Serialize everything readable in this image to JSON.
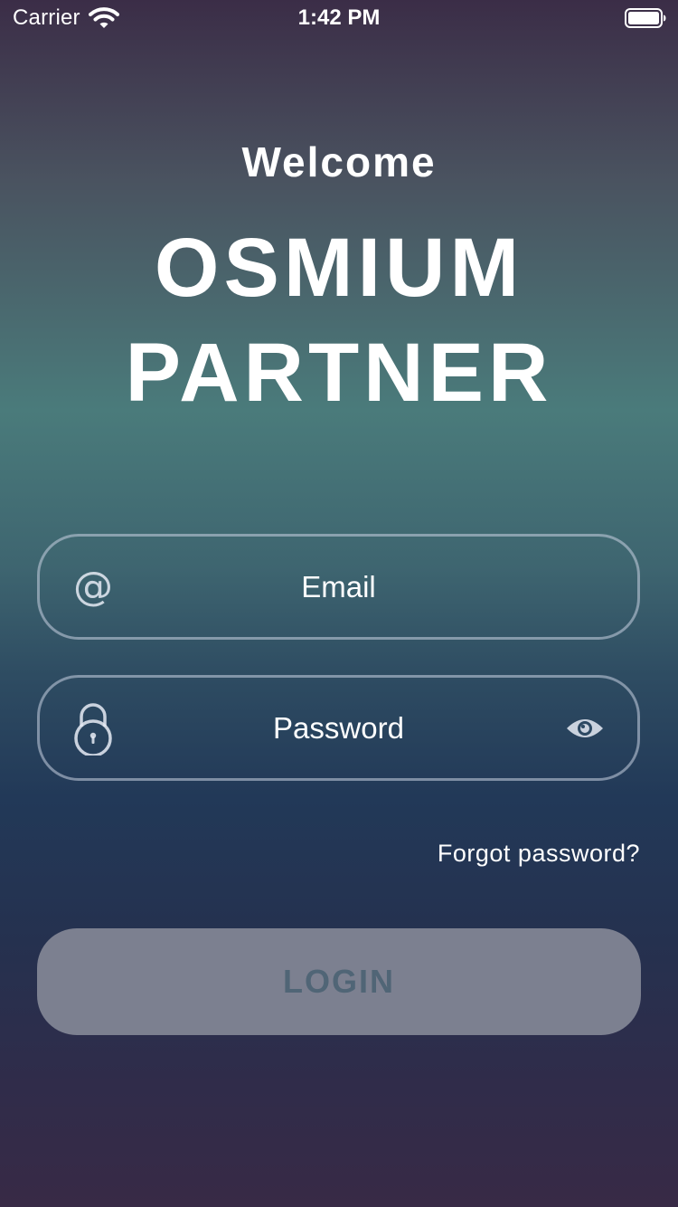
{
  "status_bar": {
    "carrier": "Carrier",
    "time": "1:42 PM",
    "icons": [
      "wifi-icon",
      "battery-icon"
    ]
  },
  "header": {
    "welcome": "Welcome",
    "brand_line_1": "OSMIUM",
    "brand_line_2": "PARTNER"
  },
  "form": {
    "email": {
      "value": "",
      "placeholder": "Email",
      "icon": "at-icon"
    },
    "password": {
      "value": "",
      "placeholder": "Password",
      "icon": "lock-icon",
      "toggle_icon": "eye-icon"
    },
    "forgot_password": "Forgot password?",
    "login_label": "LOGIN"
  },
  "colors": {
    "text": "#ffffff",
    "field_border": "#c8d2e1",
    "button_bg": "#7c8090",
    "button_text": "#506576"
  }
}
